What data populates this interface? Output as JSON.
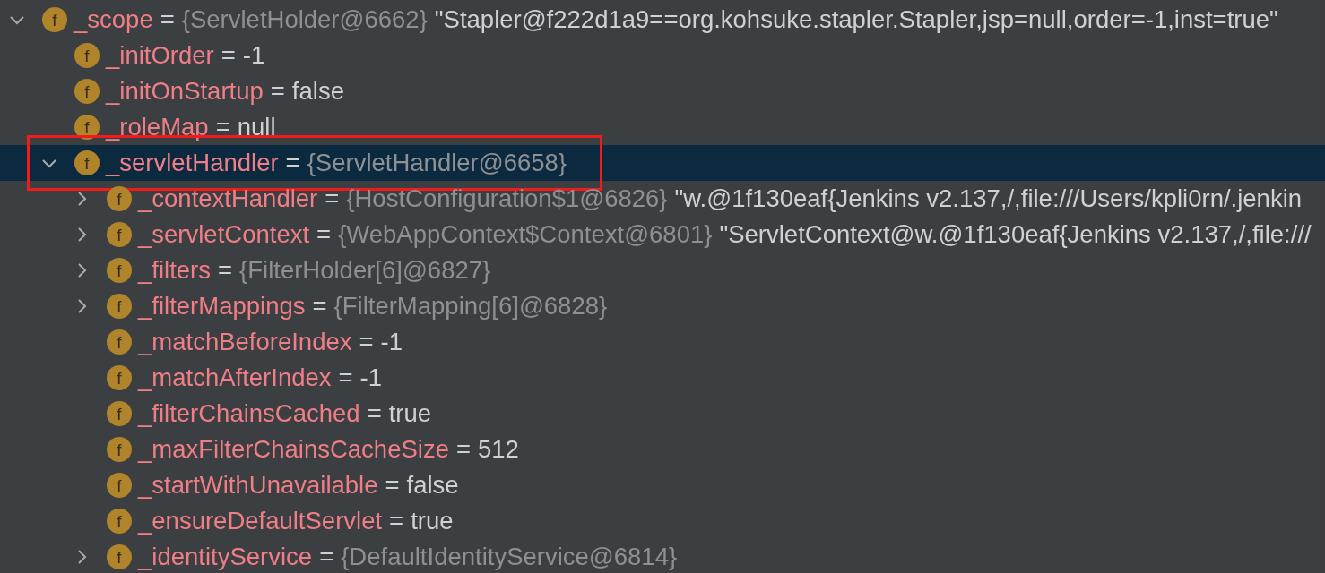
{
  "variables": [
    {
      "name": "_scope",
      "operator": "=",
      "type": "{ServletHolder@6662}",
      "value": "\"Stapler@f222d1a9==org.kohsuke.stapler.Stapler,jsp=null,order=-1,inst=true\"",
      "icon": "f",
      "expanded": true,
      "selected": false,
      "highlighted": false,
      "children": [
        {
          "name": "_initOrder",
          "operator": "=",
          "value": "-1",
          "icon": "f",
          "selected": false,
          "highlighted": false
        },
        {
          "name": "_initOnStartup",
          "operator": "=",
          "value": "false",
          "icon": "f",
          "selected": false,
          "highlighted": false
        },
        {
          "name": "_roleMap",
          "operator": "=",
          "value": "null",
          "icon": "f",
          "selected": false,
          "highlighted": false
        },
        {
          "name": "_servletHandler",
          "operator": "=",
          "type": "{ServletHandler@6658}",
          "icon": "f",
          "expanded": true,
          "selected": true,
          "highlighted": true,
          "children": [
            {
              "name": "_contextHandler",
              "operator": "=",
              "type": "{HostConfiguration$1@6826}",
              "value": "\"w.@1f130eaf{Jenkins v2.137,/,file:///Users/kpli0rn/.jenkin",
              "icon": "f",
              "expanded": false,
              "selected": false,
              "highlighted": false
            },
            {
              "name": "_servletContext",
              "operator": "=",
              "type": "{WebAppContext$Context@6801}",
              "value": "\"ServletContext@w.@1f130eaf{Jenkins v2.137,/,file:///",
              "icon": "f",
              "expanded": false,
              "selected": false,
              "highlighted": false
            },
            {
              "name": "_filters",
              "operator": "=",
              "type": "{FilterHolder[6]@6827}",
              "icon": "f",
              "expanded": false,
              "selected": false,
              "highlighted": false
            },
            {
              "name": "_filterMappings",
              "operator": "=",
              "type": "{FilterMapping[6]@6828}",
              "icon": "f",
              "expanded": false,
              "selected": false,
              "highlighted": false
            },
            {
              "name": "_matchBeforeIndex",
              "operator": "=",
              "value": "-1",
              "icon": "f",
              "selected": false,
              "highlighted": false
            },
            {
              "name": "_matchAfterIndex",
              "operator": "=",
              "value": "-1",
              "icon": "f",
              "selected": false,
              "highlighted": false
            },
            {
              "name": "_filterChainsCached",
              "operator": "=",
              "value": "true",
              "icon": "f",
              "selected": false,
              "highlighted": false
            },
            {
              "name": "_maxFilterChainsCacheSize",
              "operator": "=",
              "value": "512",
              "icon": "f",
              "selected": false,
              "highlighted": false
            },
            {
              "name": "_startWithUnavailable",
              "operator": "=",
              "value": "false",
              "icon": "f",
              "selected": false,
              "highlighted": false
            },
            {
              "name": "_ensureDefaultServlet",
              "operator": "=",
              "value": "true",
              "icon": "f",
              "selected": false,
              "highlighted": false
            },
            {
              "name": "_identityService",
              "operator": "=",
              "type": "{DefaultIdentityService@6814}",
              "icon": "f",
              "expanded": false,
              "selected": false,
              "highlighted": false
            }
          ]
        }
      ]
    }
  ]
}
